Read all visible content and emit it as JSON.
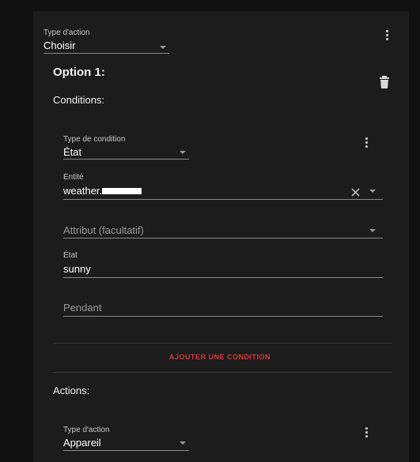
{
  "action": {
    "type_label": "Type d'action",
    "type_value": "Choisir"
  },
  "option": {
    "title": "Option 1:",
    "conditions_heading": "Conditions:",
    "condition": {
      "type_label": "Type de condition",
      "type_value": "État",
      "entity_label": "Entité",
      "entity_value": "weather.",
      "attribute_placeholder": "Attribut (facultatif)",
      "state_label": "État",
      "state_value": "sunny",
      "for_placeholder": "Pendant"
    },
    "add_condition_label": "AJOUTER UNE CONDITION",
    "actions_heading": "Actions:",
    "action": {
      "type_label": "Type d'action",
      "type_value": "Appareil"
    }
  },
  "colors": {
    "accent": "#d63c3c",
    "card_bg": "#1c1c1c",
    "page_bg": "#111111"
  },
  "icons": [
    "more-vert-icon",
    "delete-icon",
    "close-icon",
    "dropdown-arrow-icon"
  ]
}
